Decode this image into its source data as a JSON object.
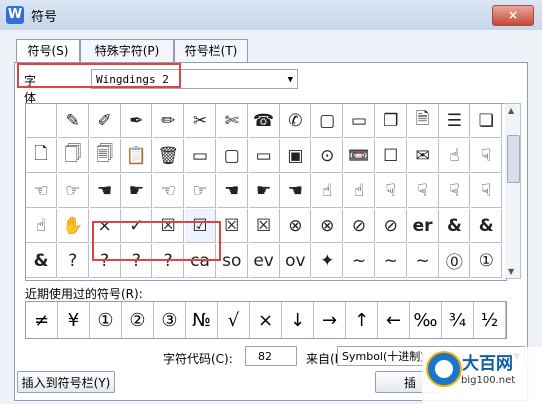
{
  "window": {
    "title": "符号",
    "app_icon_letter": "W",
    "close": "×"
  },
  "tabs": [
    {
      "label": "符号(S)"
    },
    {
      "label": "特殊字符(P)"
    },
    {
      "label": "符号栏(T)"
    }
  ],
  "font": {
    "label": "字体(F):",
    "value": "Wingdings 2"
  },
  "grid": {
    "rows": [
      [
        "",
        "✎",
        "✐",
        "✒",
        "✏",
        "✂",
        "✄",
        "☎",
        "✆",
        "▢",
        "▭",
        "❐",
        "🗎",
        "☰",
        "❏"
      ],
      [
        "🗋",
        "🗍",
        "🗐",
        "📋",
        "🗑",
        "▭",
        "▢",
        "▭",
        "▣",
        "⊙",
        "📼",
        "☐",
        "✉",
        "☝",
        "☟"
      ],
      [
        "☜",
        "☞",
        "☚",
        "☛",
        "☜",
        "☞",
        "☚",
        "☛",
        "☚",
        "☝",
        "☝",
        "☟",
        "☟",
        "☟",
        "☟"
      ],
      [
        "☝",
        "✋",
        "×",
        "✓",
        "☒",
        "☑",
        "☒",
        "☒",
        "⊗",
        "⊗",
        "⊘",
        "⊘",
        "er",
        "&",
        "&"
      ],
      [
        "&",
        "?",
        "?",
        "?",
        "?",
        "ca",
        "so",
        "ev",
        "ov",
        "✦",
        "~",
        "~",
        "~",
        "⓪",
        "①"
      ]
    ]
  },
  "recent": {
    "label": "近期使用过的符号(R):",
    "items": [
      "≠",
      "¥",
      "①",
      "②",
      "③",
      "№",
      "√",
      "×",
      "↓",
      "→",
      "↑",
      "←",
      "‰",
      "¾",
      "½"
    ]
  },
  "code": {
    "label": "字符代码(C):",
    "value": "82",
    "from_label": "来自(M)",
    "from_value": "Symbol(十进制)"
  },
  "buttons": {
    "insert_to_bar": "插入到符号栏(Y)",
    "insert": "插"
  },
  "watermark": {
    "brand": "大百网",
    "url": "big100.net"
  }
}
